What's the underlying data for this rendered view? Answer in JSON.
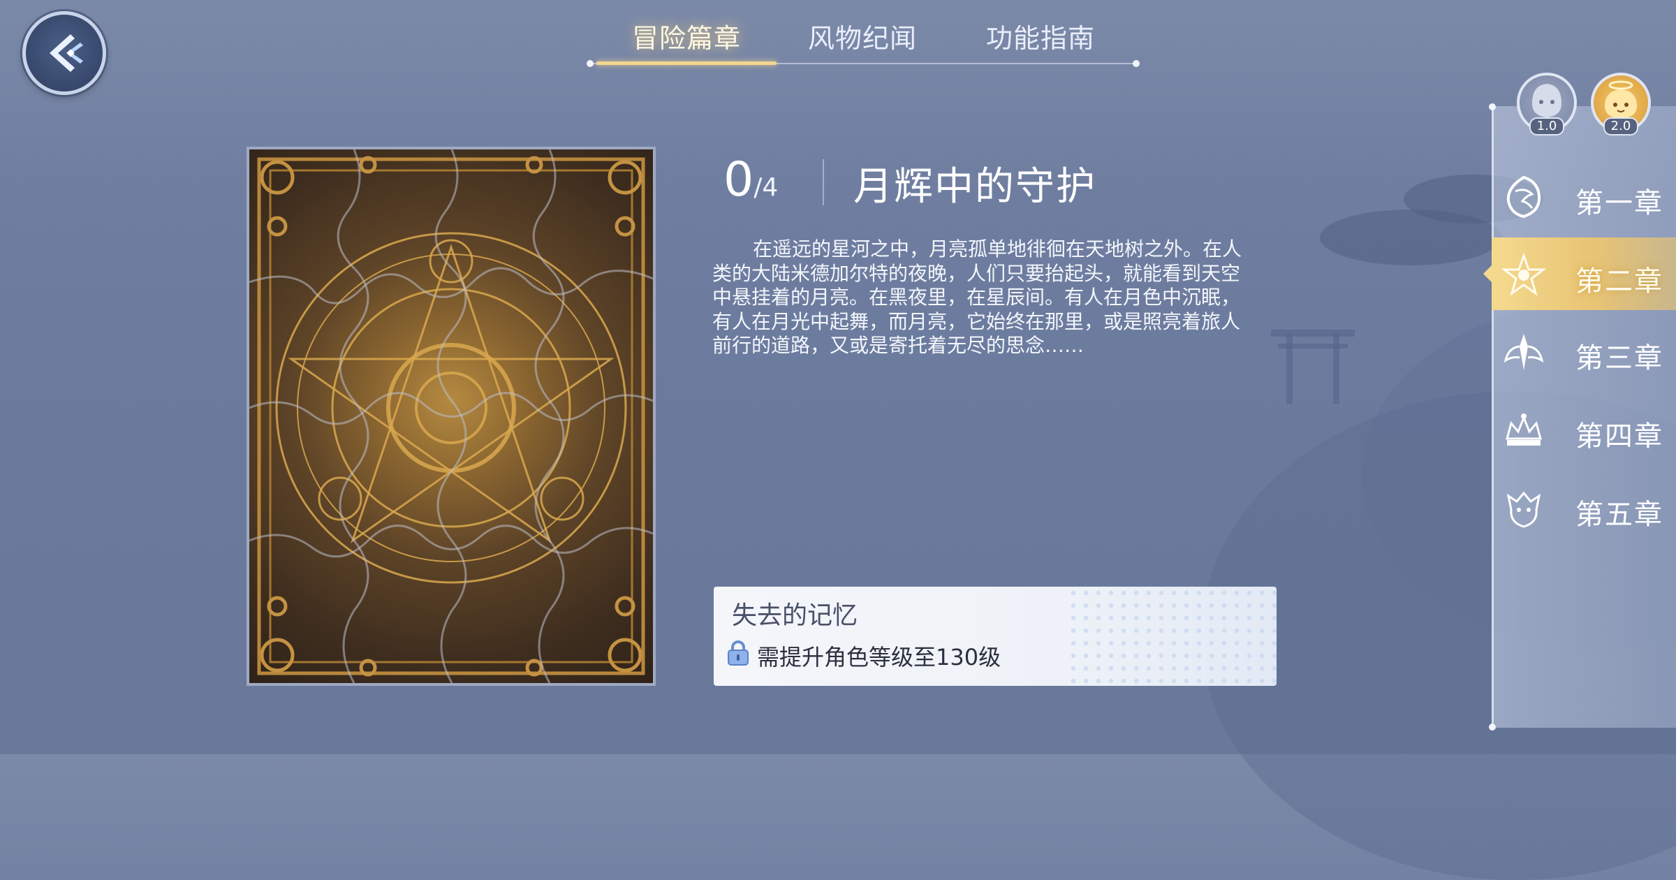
{
  "top_tabs": [
    {
      "label": "冒险篇章",
      "active": true
    },
    {
      "label": "风物纪闻",
      "active": false
    },
    {
      "label": "功能指南",
      "active": false
    }
  ],
  "chapter": {
    "progress_current": "0",
    "progress_total": "/4",
    "title": "月辉中的守护",
    "description": "在遥远的星河之中，月亮孤单地徘徊在天地树之外。在人类的大陆米德加尔特的夜晚，人们只要抬起头，就能看到天空中悬挂着的月亮。在黑夜里，在星辰间。有人在月色中沉眠，有人在月光中起舞，而月亮，它始终在那里，或是照亮着旅人前行的道路，又或是寄托着无尽的思念……"
  },
  "memory_card": {
    "title": "失去的记忆",
    "requirement": "需提升角色等级至130级",
    "locked": true
  },
  "version_badges": [
    {
      "label": "1.0",
      "icon": "ghost-mascot-icon"
    },
    {
      "label": "2.0",
      "icon": "angel-mascot-icon"
    }
  ],
  "chapters": [
    {
      "label": "第一章",
      "icon": "dragon-emblem-icon",
      "active": false
    },
    {
      "label": "第二章",
      "icon": "star-emblem-icon",
      "active": true
    },
    {
      "label": "第三章",
      "icon": "wing-emblem-icon",
      "active": false
    },
    {
      "label": "第四章",
      "icon": "crown-emblem-icon",
      "active": false
    },
    {
      "label": "第五章",
      "icon": "beast-emblem-icon",
      "active": false
    }
  ],
  "colors": {
    "background": "#6f7ea0",
    "accent_gold": "#f3d68f",
    "active_chapter": "#f5da8e",
    "card_bg": "#f4f6fa"
  }
}
